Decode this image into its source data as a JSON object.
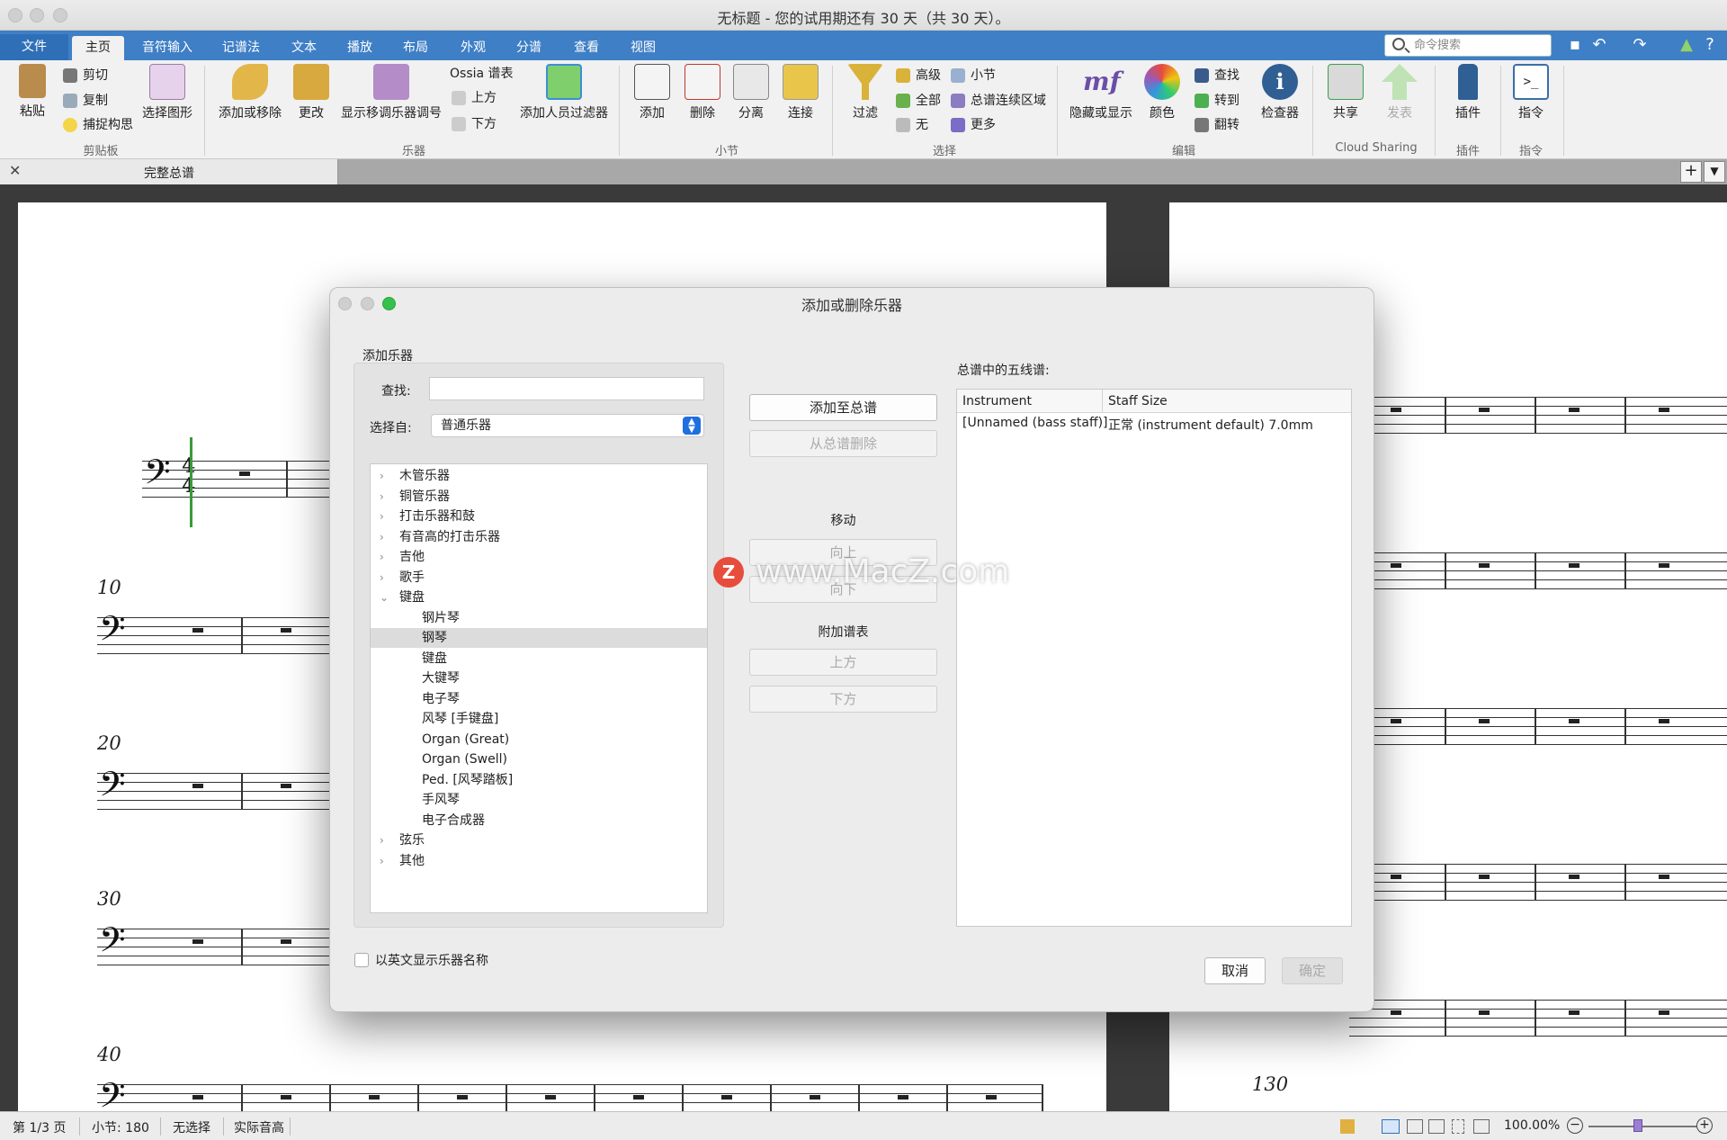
{
  "window": {
    "title": "无标题 - 您的试用期还有 30 天（共 30 天）。"
  },
  "ribbon_tabs": [
    "文件",
    "主页",
    "音符输入",
    "记谱法",
    "文本",
    "播放",
    "布局",
    "外观",
    "分谱",
    "查看",
    "视图"
  ],
  "command_search": {
    "placeholder": "命令搜索"
  },
  "ribbon": {
    "clipboard": {
      "label": "剪贴板",
      "paste": "粘贴",
      "cut": "剪切",
      "copy": "复制",
      "capture": "捕捉构思",
      "select_graphic": "选择图形"
    },
    "instruments": {
      "label": "乐器",
      "add_remove": "添加或移除",
      "change": "更改",
      "show_transposing": "显示移调乐器调号",
      "ossia": "Ossia 谱表",
      "above": "上方",
      "below": "下方",
      "add_player_filter": "添加人员过滤器"
    },
    "bars": {
      "label": "小节",
      "add": "添加",
      "delete": "删除",
      "split": "分离",
      "join": "连接"
    },
    "select": {
      "label": "选择",
      "filter": "过滤",
      "advanced": "高级",
      "all": "全部",
      "none": "无",
      "bar": "小节",
      "system_passage": "总谱连续区域",
      "more": "更多"
    },
    "edit": {
      "label": "编辑",
      "hide_show": "隐藏或显示",
      "color": "颜色",
      "find": "查找",
      "goto": "转到",
      "flip": "翻转",
      "inspector": "检查器"
    },
    "cloud": {
      "label": "Cloud Sharing",
      "share": "共享",
      "publish": "发表"
    },
    "plugins": {
      "label": "插件",
      "plugins": "插件"
    },
    "commands": {
      "label": "指令",
      "commands": "指令"
    }
  },
  "doc_tab": {
    "label": "完整总谱"
  },
  "score": {
    "measure_numbers": [
      "10",
      "20",
      "30",
      "40",
      "130"
    ]
  },
  "dialog": {
    "title": "添加或删除乐器",
    "add_section": "添加乐器",
    "find_label": "查找:",
    "find_value": "",
    "choose_from_label": "选择自:",
    "choose_from_value": "普通乐器",
    "tree": [
      {
        "label": "木管乐器",
        "level": 0,
        "expanded": false
      },
      {
        "label": "铜管乐器",
        "level": 0,
        "expanded": false
      },
      {
        "label": "打击乐器和鼓",
        "level": 0,
        "expanded": false
      },
      {
        "label": "有音高的打击乐器",
        "level": 0,
        "expanded": false
      },
      {
        "label": "吉他",
        "level": 0,
        "expanded": false
      },
      {
        "label": "歌手",
        "level": 0,
        "expanded": false
      },
      {
        "label": "键盘",
        "level": 0,
        "expanded": true
      },
      {
        "label": "钢片琴",
        "level": 1
      },
      {
        "label": "钢琴",
        "level": 1,
        "selected": true
      },
      {
        "label": "键盘",
        "level": 1
      },
      {
        "label": "大键琴",
        "level": 1
      },
      {
        "label": "电子琴",
        "level": 1
      },
      {
        "label": "风琴 [手键盘]",
        "level": 1
      },
      {
        "label": "Organ (Great)",
        "level": 1
      },
      {
        "label": "Organ (Swell)",
        "level": 1
      },
      {
        "label": "Ped. [风琴踏板]",
        "level": 1
      },
      {
        "label": "手风琴",
        "level": 1
      },
      {
        "label": "电子合成器",
        "level": 1
      },
      {
        "label": "弦乐",
        "level": 0,
        "expanded": false
      },
      {
        "label": "其他",
        "level": 0,
        "expanded": false
      }
    ],
    "buttons": {
      "add_to_score": "添加至总谱",
      "remove_from_score": "从总谱删除",
      "move_heading": "移动",
      "up": "向上",
      "down": "向下",
      "extra_staves_heading": "附加谱表",
      "above": "上方",
      "below": "下方",
      "cancel": "取消",
      "ok": "确定"
    },
    "staves_label": "总谱中的五线谱:",
    "staves_table": {
      "columns": [
        "Instrument",
        "Staff Size"
      ],
      "rows": [
        [
          "[Unnamed (bass staff)]",
          "正常 (instrument default) 7.0mm"
        ]
      ]
    },
    "english_names_checkbox": "以英文显示乐器名称"
  },
  "watermark": {
    "text": "www.MacZ.com",
    "badge": "Z"
  },
  "status_bar": {
    "page": "第 1/3 页",
    "bar": "小节: 180",
    "selection": "无选择",
    "pitch": "实际音高",
    "zoom": "100.00%"
  },
  "colors": {
    "ribbon_blue": "#3e7fc6",
    "traffic_green": "#35c14b",
    "select_blue": "#1f6fe0"
  }
}
